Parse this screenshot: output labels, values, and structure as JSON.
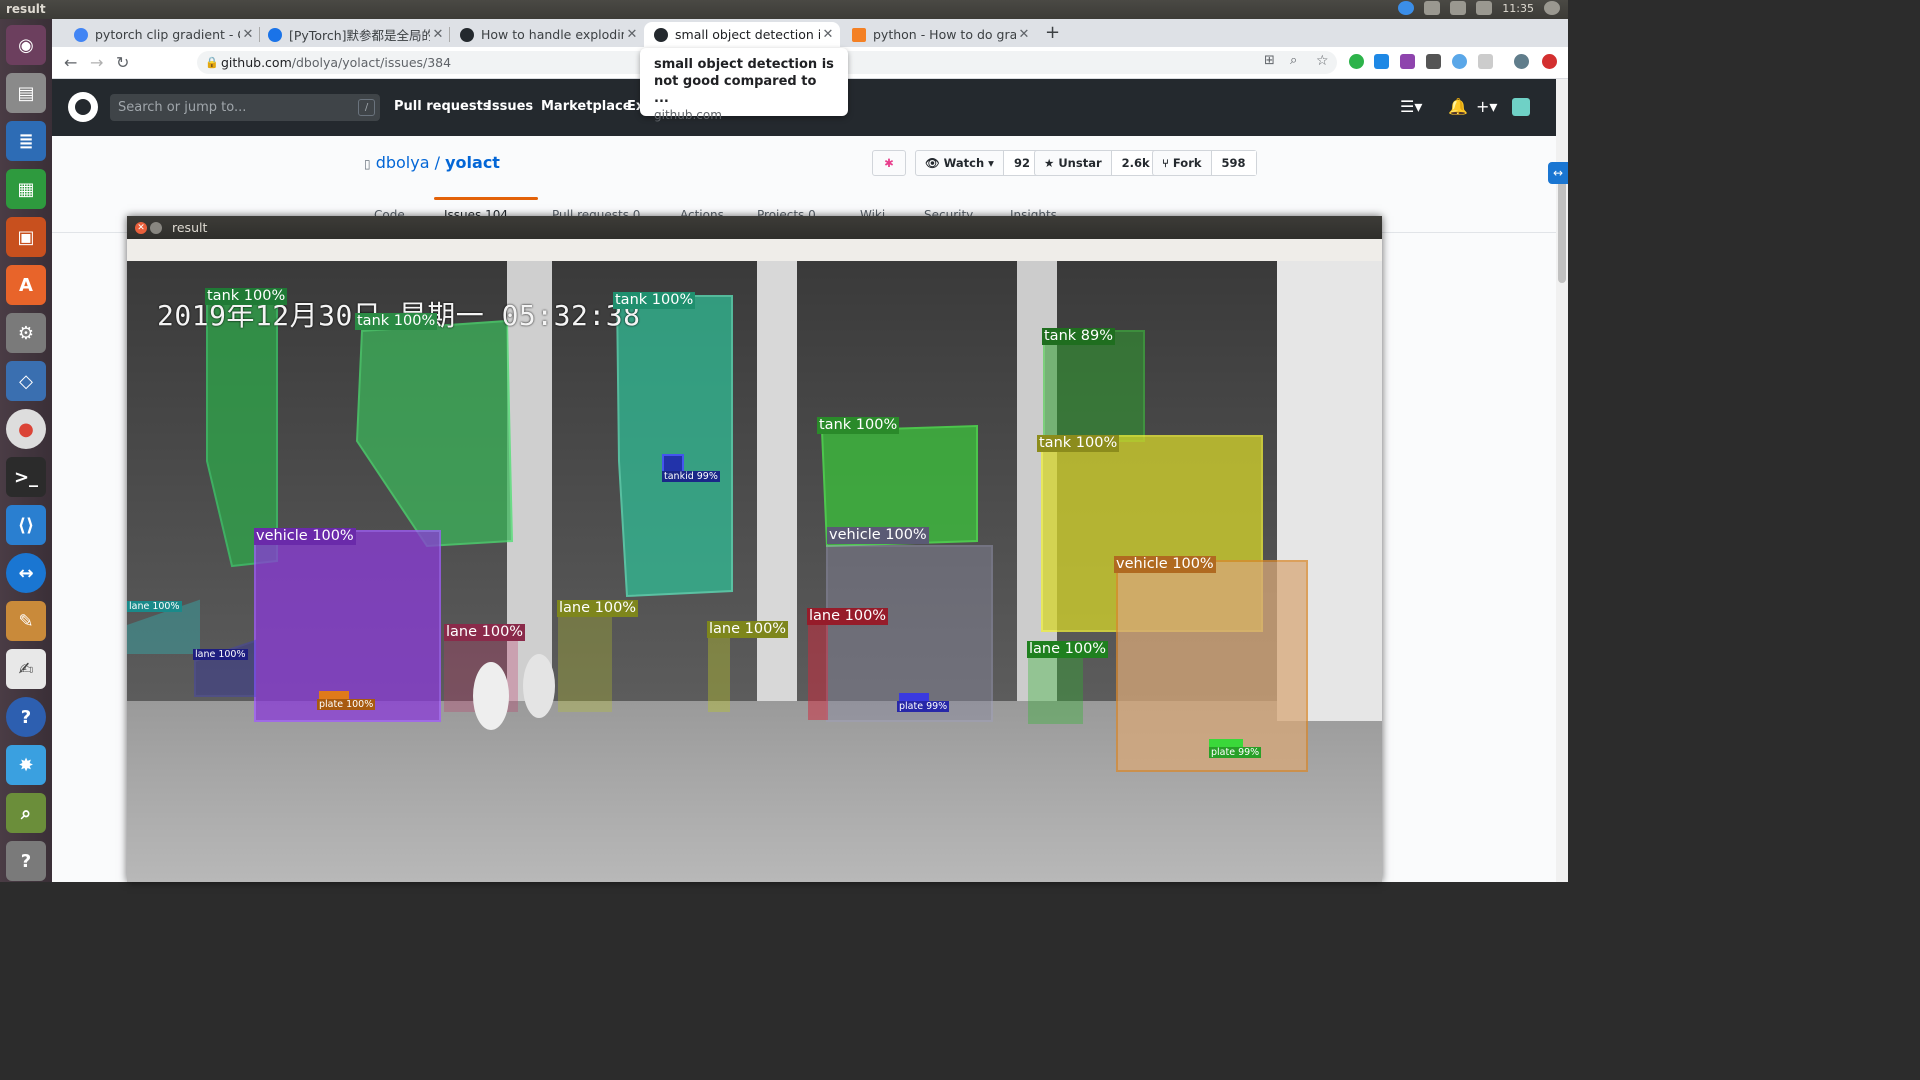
{
  "topbar": {
    "title": "result",
    "time": "11:35"
  },
  "tabs": [
    {
      "title": "pytorch clip gradient - Go",
      "color": "#4285f4"
    },
    {
      "title": "[PyTorch]默参都是全局的",
      "color": "#1a73e8"
    },
    {
      "title": "How to handle exploding",
      "color": "#24292e"
    },
    {
      "title": "small object detection is r",
      "color": "#24292e"
    },
    {
      "title": "python - How to do gradi",
      "color": "#f48024"
    }
  ],
  "address": {
    "domain": "github.com",
    "path": "/dbolya/yolact/issues/384"
  },
  "tooltip": {
    "title": "small object detection is not good compared to ...",
    "domain": "github.com"
  },
  "github": {
    "search_placeholder": "Search or jump to...",
    "search_key": "/",
    "nav": [
      "Pull requests",
      "Issues",
      "Marketplace",
      "Ex"
    ],
    "owner": "dbolya",
    "slash": "/",
    "repo": "yolact",
    "watch_label": "Watch",
    "watch_count": "92",
    "star_label": "Unstar",
    "star_count": "2.6k",
    "fork_label": "Fork",
    "fork_count": "598",
    "tabs": [
      "Code",
      "Issues 104",
      "Pull requests 0",
      "Actions",
      "Projects 0",
      "Wiki",
      "Security",
      "Insights"
    ]
  },
  "result_window": {
    "title": "result",
    "timestamp": "2019年12月30日  星期一  05:32:38",
    "detections": [
      {
        "label": "tank 100%",
        "color": "#2ea84a"
      },
      {
        "label": "tank 100%",
        "color": "#3cb55a"
      },
      {
        "label": "tank 100%",
        "color": "#2fc49a"
      },
      {
        "label": "tank 89%",
        "color": "#2f9e2f"
      },
      {
        "label": "tank 100%",
        "color": "#3bc43b"
      },
      {
        "label": "tank 100%",
        "color": "#d6d62a"
      },
      {
        "label": "tankid 99%",
        "color": "#2233aa"
      },
      {
        "label": "vehicle 100%",
        "color": "#8b3bd9"
      },
      {
        "label": "vehicle 100%",
        "color": "#7a7a9a"
      },
      {
        "label": "vehicle 100%",
        "color": "#d8892f"
      },
      {
        "label": "lane 100%",
        "color": "#2cc4c4"
      },
      {
        "label": "lane 100%",
        "color": "#2a2ab0"
      },
      {
        "label": "lane 100%",
        "color": "#c03a6a"
      },
      {
        "label": "lane 100%",
        "color": "#b9c42a"
      },
      {
        "label": "lane 100%",
        "color": "#b9c42a"
      },
      {
        "label": "lane 100%",
        "color": "#d0283c"
      },
      {
        "label": "lane 100%",
        "color": "#2cb82c"
      },
      {
        "label": "plate 100%",
        "color": "#e07a1a"
      },
      {
        "label": "plate 99%",
        "color": "#3a3ae0"
      },
      {
        "label": "plate 99%",
        "color": "#3ad83a"
      }
    ]
  }
}
